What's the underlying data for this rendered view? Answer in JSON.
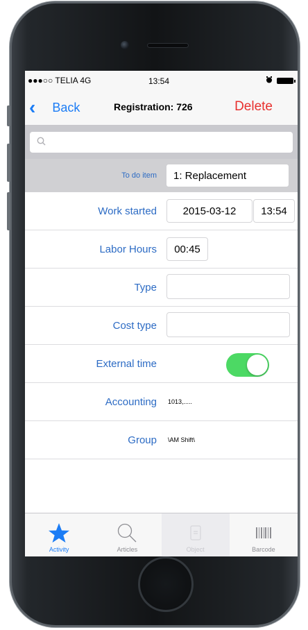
{
  "status": {
    "carrier": "●●●○○ TELIA 4G",
    "time": "13:54"
  },
  "nav": {
    "back_label": "Back",
    "title": "Registration: 726",
    "delete_label": "Delete"
  },
  "search": {
    "placeholder": ""
  },
  "form": {
    "todo_label": "To do item",
    "todo_value": "1: Replacement",
    "work_started_label": "Work started",
    "work_started_date": "2015-03-12",
    "work_started_time": "13:54",
    "labor_hours_label": "Labor Hours",
    "labor_hours_value": "00:45",
    "type_label": "Type",
    "type_value": "",
    "cost_type_label": "Cost type",
    "cost_type_value": "",
    "external_time_label": "External time",
    "external_time_on": true,
    "accounting_label": "Accounting",
    "accounting_value": "1013,.....",
    "group_label": "Group",
    "group_value": "\\AM Shift\\"
  },
  "tabs": [
    {
      "label": "Activity",
      "icon": "star-icon",
      "state": "active"
    },
    {
      "label": "Articles",
      "icon": "magnifier-icon",
      "state": "normal"
    },
    {
      "label": "Object",
      "icon": "document-icon",
      "state": "disabled"
    },
    {
      "label": "Barcode",
      "icon": "barcode-icon",
      "state": "normal"
    }
  ],
  "colors": {
    "accent": "#1b7cf5",
    "delete": "#e8302e",
    "toggle_on": "#4cd964",
    "label": "#2c6bc4"
  }
}
